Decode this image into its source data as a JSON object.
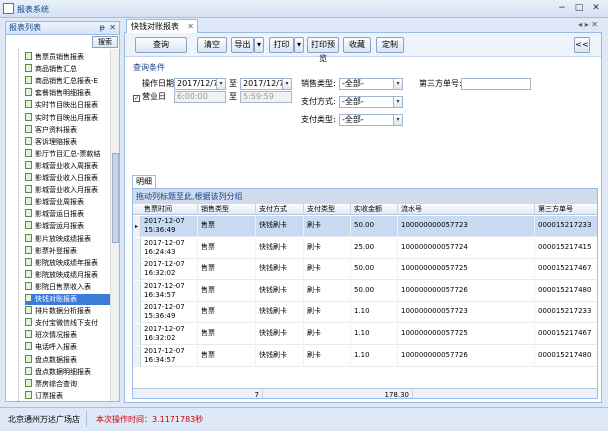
{
  "app": {
    "title": "报表系统"
  },
  "left_panel": {
    "title": "报表列表",
    "pin": "ᵽ",
    "close": "✕",
    "search_label": "搜索",
    "items": [
      {
        "label": "售票员销售报表"
      },
      {
        "label": "商品销售汇总"
      },
      {
        "label": "商品销售汇总报表-E"
      },
      {
        "label": "套餐销售明细报表"
      },
      {
        "label": "实时节目映出日报表"
      },
      {
        "label": "实时节目映出月报表"
      },
      {
        "label": "客户资料报表"
      },
      {
        "label": "客诉理赔报表"
      },
      {
        "label": "影厅节目汇总-票款结"
      },
      {
        "label": "影城营业收入周报表"
      },
      {
        "label": "影城营业收入日报表"
      },
      {
        "label": "影城营业收入月报表"
      },
      {
        "label": "影城营业周报表"
      },
      {
        "label": "影城营运日报表"
      },
      {
        "label": "影城营运月报表"
      },
      {
        "label": "影片放映成绩报表"
      },
      {
        "label": "影票补登报表"
      },
      {
        "label": "影院放映成绩年报表"
      },
      {
        "label": "影院放映成绩月报表"
      },
      {
        "label": "影院日售票收入表"
      },
      {
        "label": "快钱对账报表",
        "selected": true
      },
      {
        "label": "排片数据分析报表"
      },
      {
        "label": "支付宝微信线下支付"
      },
      {
        "label": "班次情况报表"
      },
      {
        "label": "电话呼入报表"
      },
      {
        "label": "盘点数据报表"
      },
      {
        "label": "盘点数据明细报表"
      },
      {
        "label": "票房综合查询"
      },
      {
        "label": "订票报表"
      }
    ]
  },
  "tab": {
    "label": "快钱对账报表",
    "close": "✕",
    "controls": "◂ ▸ ✕"
  },
  "toolbar": {
    "query": "查询",
    "clear": "清空",
    "export": "导出",
    "print": "打印",
    "print_preview": "打印预览",
    "favorite": "收藏",
    "customize": "定制",
    "collapse": "<<",
    "dropdown_arrow": "▾"
  },
  "query": {
    "section_title": "查询条件",
    "op_date_label": "操作日期:",
    "op_date_from": "2017/12/7",
    "to_label": "至",
    "op_date_to": "2017/12/7",
    "business_day_label": "营业日",
    "time_from": "6:00:00",
    "time_to": "5:59:59",
    "sale_type_label": "销售类型:",
    "sale_type_value": "-全部-",
    "pay_method_label": "支付方式:",
    "pay_method_value": "-全部-",
    "pay_type_label": "支付类型:",
    "pay_type_value": "-全部-",
    "third_party_label": "第三方单号:",
    "third_party_value": ""
  },
  "detail": {
    "tab_label": "明细",
    "group_hint": "拖动列标题至此,根据该列分组",
    "columns": [
      "售票时间",
      "销售类型",
      "支付方式",
      "支付类型",
      "实收金额",
      "流水号",
      "第三方单号"
    ],
    "rows": [
      {
        "time_date": "2017-12-07",
        "time_clock": "15:36:49",
        "sale_type": "售票",
        "pay_method": "快钱刷卡",
        "pay_type": "刷卡",
        "amount": "50.00",
        "serial": "100000000057723",
        "third": "000015217233",
        "selected": true
      },
      {
        "time_date": "2017-12-07",
        "time_clock": "16:24:43",
        "sale_type": "售票",
        "pay_method": "快钱刷卡",
        "pay_type": "刷卡",
        "amount": "25.00",
        "serial": "100000000057724",
        "third": "000015217415"
      },
      {
        "time_date": "2017-12-07",
        "time_clock": "16:32:02",
        "sale_type": "售票",
        "pay_method": "快钱刷卡",
        "pay_type": "刷卡",
        "amount": "50.00",
        "serial": "100000000057725",
        "third": "000015217467"
      },
      {
        "time_date": "2017-12-07",
        "time_clock": "16:34:57",
        "sale_type": "售票",
        "pay_method": "快钱刷卡",
        "pay_type": "刷卡",
        "amount": "50.00",
        "serial": "100000000057726",
        "third": "000015217480"
      },
      {
        "time_date": "2017-12-07",
        "time_clock": "15:36:49",
        "sale_type": "售票",
        "pay_method": "快钱刷卡",
        "pay_type": "刷卡",
        "amount": "1.10",
        "serial": "100000000057723",
        "third": "000015217233"
      },
      {
        "time_date": "2017-12-07",
        "time_clock": "16:32:02",
        "sale_type": "售票",
        "pay_method": "快钱刷卡",
        "pay_type": "刷卡",
        "amount": "1.10",
        "serial": "100000000057725",
        "third": "000015217467"
      },
      {
        "time_date": "2017-12-07",
        "time_clock": "16:34:57",
        "sale_type": "售票",
        "pay_method": "快钱刷卡",
        "pay_type": "刷卡",
        "amount": "1.10",
        "serial": "100000000057726",
        "third": "000015217480"
      }
    ],
    "footer_count": "7",
    "footer_total": "178.30"
  },
  "status": {
    "location": "北京通州万达广场店",
    "elapsed": "本次操作时间：3.1171783秒"
  },
  "colors": {
    "selected": "#3b7bd9",
    "accent": "#15428b"
  }
}
